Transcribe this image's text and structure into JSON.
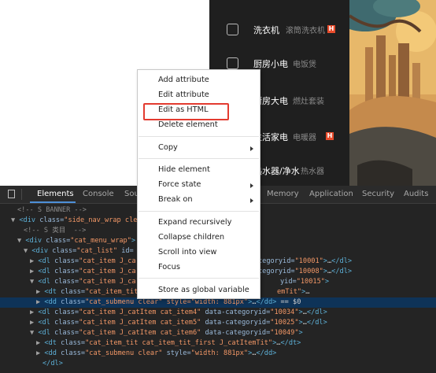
{
  "webpage": {
    "sidebar": [
      {
        "title": "洗衣机",
        "sub": "滚筒洗衣机",
        "hot": "H",
        "icon": "washer-icon"
      },
      {
        "title": "厨房小电",
        "sub": "电饭煲",
        "icon": "microwave-icon"
      },
      {
        "title": "厨房大电",
        "sub": "燃灶套装",
        "icon": "stove-icon"
      },
      {
        "title": "生活家电",
        "sub": "电暖器",
        "hot": "H",
        "icon": "appliance-icon"
      },
      {
        "title": "热水器/净水",
        "sub": "热水器",
        "icon": "water-heater-icon"
      }
    ]
  },
  "devtools": {
    "tabs": [
      "Elements",
      "Console",
      "Sou",
      "Memory",
      "Application",
      "Security",
      "Audits"
    ],
    "active_tab": "Elements",
    "lines": [
      {
        "t": [
          [
            "cmt",
            "<!-- S BANNER -->"
          ]
        ]
      },
      {
        "t": [
          [
            "arrow",
            "▼"
          ],
          [
            "tag",
            "<div "
          ],
          [
            "attr",
            "class="
          ],
          [
            "val",
            "\"side_nav_wrap cle"
          ]
        ]
      },
      {
        "t": [
          [
            "cmt",
            "<!-- S 类目  -->"
          ]
        ]
      },
      {
        "t": [
          [
            "arrow",
            "▼"
          ],
          [
            "tag",
            "<div "
          ],
          [
            "attr",
            "class="
          ],
          [
            "val",
            "\"cat_menu_wrap\""
          ],
          [
            "tag",
            ">"
          ]
        ]
      },
      {
        "t": [
          [
            "arrow",
            "▼"
          ],
          [
            "tag",
            "<div "
          ],
          [
            "attr",
            "class="
          ],
          [
            "val",
            "\"cat_list\""
          ],
          [
            "attr",
            " id="
          ]
        ]
      },
      {
        "t": [
          [
            "arrow",
            "▶"
          ],
          [
            "tag",
            "<dl "
          ],
          [
            "attr",
            "class="
          ],
          [
            "val",
            "\"cat_item J_ca"
          ]
        ],
        "tail": [
          [
            "attr",
            "tegoryid="
          ],
          [
            "val",
            "\"10001\""
          ],
          [
            "tag",
            ">"
          ],
          [
            "txt",
            "…"
          ],
          [
            "tag",
            "</dl>"
          ]
        ]
      },
      {
        "t": [
          [
            "arrow",
            "▶"
          ],
          [
            "tag",
            "<dl "
          ],
          [
            "attr",
            "class="
          ],
          [
            "val",
            "\"cat_item J_ca"
          ]
        ],
        "tail": [
          [
            "attr",
            "tegoryid="
          ],
          [
            "val",
            "\"10008\""
          ],
          [
            "tag",
            ">"
          ],
          [
            "txt",
            "…"
          ],
          [
            "tag",
            "</dl>"
          ]
        ]
      },
      {
        "t": [
          [
            "arrow",
            "▼"
          ],
          [
            "tag",
            "<dl "
          ],
          [
            "attr",
            "class="
          ],
          [
            "val",
            "\"cat_item J_ca"
          ]
        ],
        "tail": [
          [
            "attr",
            "yid="
          ],
          [
            "val",
            "\"10015\""
          ],
          [
            "tag",
            ">"
          ]
        ]
      },
      {
        "t": [
          [
            "arrow",
            "▶"
          ],
          [
            "tag",
            "<dt "
          ],
          [
            "attr",
            "class="
          ],
          [
            "val",
            "\"cat_item_tit"
          ]
        ],
        "tail": [
          [
            "val",
            "emTit\""
          ],
          [
            "tag",
            ">"
          ],
          [
            "txt",
            "…"
          ]
        ]
      },
      {
        "t": [
          [
            "arrow",
            "▶"
          ],
          [
            "tag",
            "<dd "
          ],
          [
            "attr",
            "class="
          ],
          [
            "val",
            "\"cat_submenu clear\" style=\"width: 881px\""
          ],
          [
            "tag",
            ">"
          ],
          [
            "txt",
            "…"
          ],
          [
            "tag",
            "</dd>"
          ],
          [
            "txt",
            " == $0"
          ]
        ],
        "sel": true
      },
      {
        "t": [
          [
            "arrow",
            "▶"
          ],
          [
            "tag",
            "<dl "
          ],
          [
            "attr",
            "class="
          ],
          [
            "val",
            "\"cat_item J_catItem cat_item4\""
          ],
          [
            "attr",
            " data-categoryid="
          ],
          [
            "val",
            "\"10034\""
          ],
          [
            "tag",
            ">"
          ],
          [
            "txt",
            "…"
          ],
          [
            "tag",
            "</dl>"
          ]
        ]
      },
      {
        "t": [
          [
            "arrow",
            "▶"
          ],
          [
            "tag",
            "<dl "
          ],
          [
            "attr",
            "class="
          ],
          [
            "val",
            "\"cat_item J_catItem cat_item5\""
          ],
          [
            "attr",
            " data-categoryid="
          ],
          [
            "val",
            "\"10025\""
          ],
          [
            "tag",
            ">"
          ],
          [
            "txt",
            "…"
          ],
          [
            "tag",
            "</dl>"
          ]
        ]
      },
      {
        "t": [
          [
            "arrow",
            "▼"
          ],
          [
            "tag",
            "<dl "
          ],
          [
            "attr",
            "class="
          ],
          [
            "val",
            "\"cat_item J_catItem cat_item6\""
          ],
          [
            "attr",
            " data-categoryid="
          ],
          [
            "val",
            "\"10049\""
          ],
          [
            "tag",
            ">"
          ]
        ]
      },
      {
        "t": [
          [
            "arrow",
            "▶"
          ],
          [
            "tag",
            "<dt "
          ],
          [
            "attr",
            "class="
          ],
          [
            "val",
            "\"cat_item_tit cat_item_tit_first J_catItemTit\""
          ],
          [
            "tag",
            ">"
          ],
          [
            "txt",
            "…"
          ],
          [
            "tag",
            "</dt>"
          ]
        ]
      },
      {
        "t": [
          [
            "arrow",
            "▶"
          ],
          [
            "tag",
            "<dd "
          ],
          [
            "attr",
            "class="
          ],
          [
            "val",
            "\"cat_submenu clear\""
          ],
          [
            "attr",
            " style="
          ],
          [
            "val",
            "\"width: 881px\""
          ],
          [
            "tag",
            ">"
          ],
          [
            "txt",
            "…"
          ],
          [
            "tag",
            "</dd>"
          ]
        ]
      },
      {
        "t": [
          [
            "tag",
            "</dl>"
          ]
        ]
      }
    ]
  },
  "context_menu": {
    "items": [
      {
        "label": "Add attribute"
      },
      {
        "label": "Edit attribute"
      },
      {
        "label": "Edit as HTML",
        "highlighted": true
      },
      {
        "label": "Delete element"
      },
      {
        "label": "Copy",
        "submenu": true
      },
      {
        "label": "Hide element"
      },
      {
        "label": "Force state",
        "submenu": true
      },
      {
        "label": "Break on",
        "submenu": true
      },
      {
        "label": "Expand recursively"
      },
      {
        "label": "Collapse children"
      },
      {
        "label": "Scroll into view"
      },
      {
        "label": "Focus"
      },
      {
        "label": "Store as global variable"
      }
    ]
  }
}
